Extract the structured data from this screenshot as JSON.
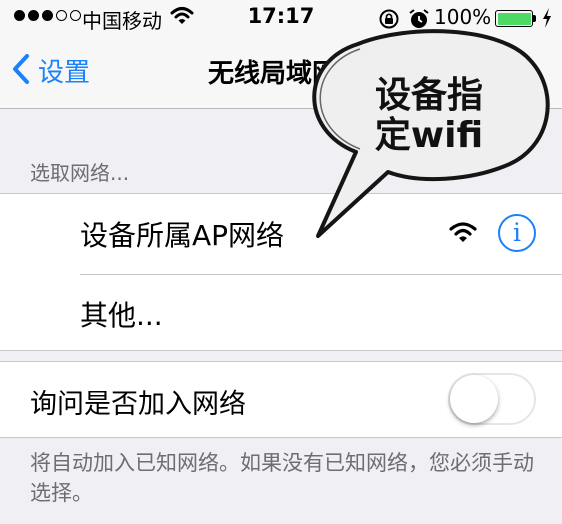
{
  "status_bar": {
    "carrier": "中国移动",
    "time": "17:17",
    "battery_percent": "100%",
    "battery_level": 1.0,
    "signal_strength": 3,
    "signal_max": 5,
    "icons": [
      "wifi-icon",
      "rotation-lock-icon",
      "alarm-icon",
      "battery-icon",
      "charging-bolt-icon"
    ]
  },
  "nav": {
    "back_label": "设置",
    "title": "无线局域网"
  },
  "networks": {
    "header": "选取网络...",
    "items": [
      {
        "label": "设备所属AP网络",
        "has_wifi_icon": true,
        "has_info_button": true
      },
      {
        "label": "其他..."
      }
    ],
    "info_glyph": "i"
  },
  "ask_to_join": {
    "label": "询问是否加入网络",
    "enabled": false
  },
  "footer_note": "将自动加入已知网络。如果没有已知网络，您必须手动选择。",
  "annotation": {
    "line1": "设备指",
    "line2": "定wifi"
  },
  "colors": {
    "accent": "#1a82fb",
    "background": "#efeff4",
    "battery": "#4cd964",
    "secondary_text": "#6d6d72"
  }
}
